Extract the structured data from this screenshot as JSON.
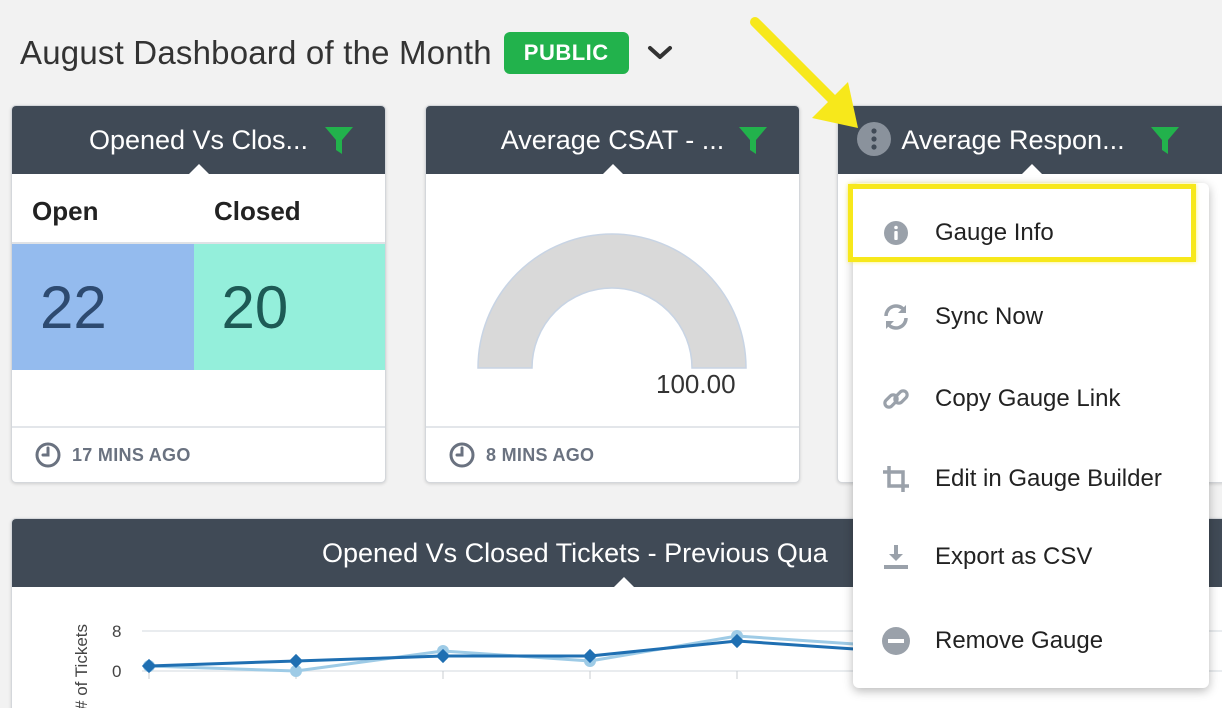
{
  "header": {
    "title": "August Dashboard of the Month",
    "badge": "PUBLIC"
  },
  "cards": {
    "opened_closed": {
      "title": "Opened Vs Clos...",
      "columns": [
        "Open",
        "Closed"
      ],
      "values": [
        "22",
        "20"
      ],
      "open_color": "#94bbee",
      "closed_color": "#94efdb",
      "updated": "17 MINS AGO"
    },
    "csat": {
      "title": "Average CSAT - ...",
      "value": "100.00",
      "gauge_fill_fraction": 1.0,
      "updated": "8 MINS AGO"
    },
    "response": {
      "title": "Average Respon..."
    },
    "prev_quarter": {
      "title": "Opened Vs Closed Tickets - Previous Qua"
    }
  },
  "chart_data": {
    "type": "line",
    "ylabel": "# of Tickets",
    "yticks": [
      "8",
      "0"
    ],
    "ylim": [
      0,
      8
    ],
    "series": [
      {
        "values": [
          1,
          2,
          3,
          3,
          6,
          4
        ],
        "color": "#1f6fb2"
      },
      {
        "values": [
          1,
          0,
          4,
          2,
          7,
          5
        ],
        "color": "#9ecbe6"
      }
    ],
    "grid": true
  },
  "menu": {
    "items": [
      {
        "label": "Gauge Info",
        "icon": "info-icon"
      },
      {
        "label": "Sync Now",
        "icon": "sync-icon"
      },
      {
        "label": "Copy Gauge Link",
        "icon": "link-icon"
      },
      {
        "label": "Edit in Gauge Builder",
        "icon": "crop-icon"
      },
      {
        "label": "Export as CSV",
        "icon": "download-icon"
      },
      {
        "label": "Remove Gauge",
        "icon": "remove-icon"
      }
    ]
  },
  "colors": {
    "header_bar": "#404a56",
    "badge_green": "#22b24c",
    "filter_green": "#22b24c",
    "highlight": "#f7e81b"
  }
}
